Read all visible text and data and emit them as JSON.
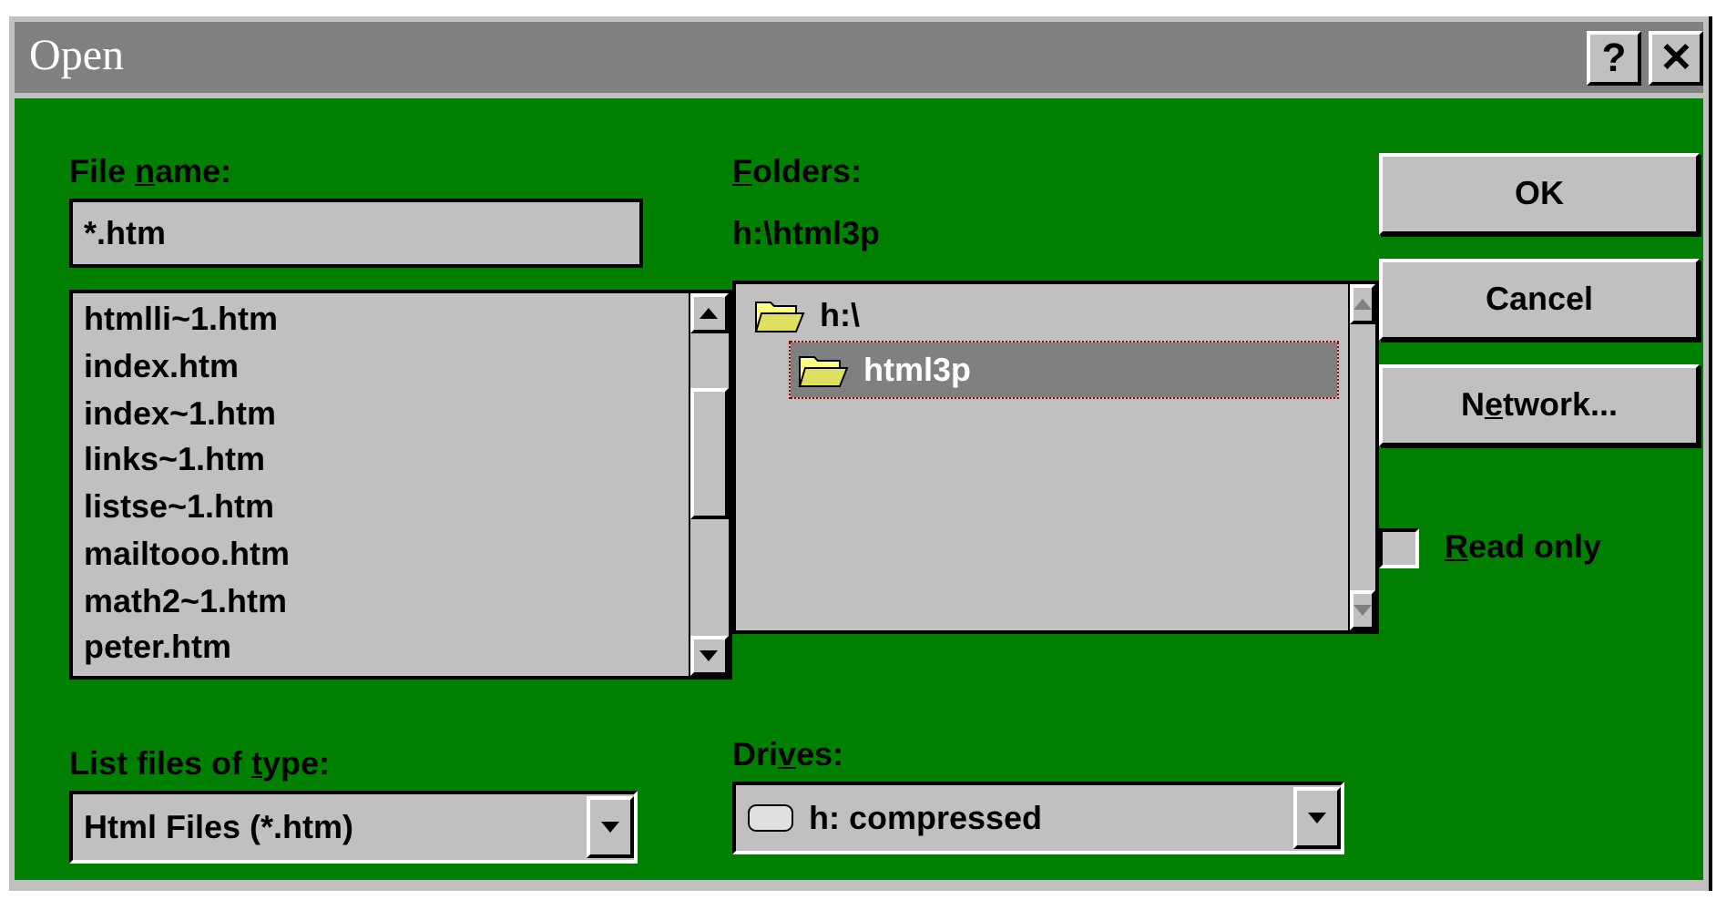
{
  "window": {
    "title": "Open",
    "title_buttons": [
      "?",
      "✕"
    ]
  },
  "file_name": {
    "label": {
      "pre": "File ",
      "key": "n",
      "post": "ame:"
    },
    "value": "*.htm"
  },
  "files": [
    {
      "name": "htmlli~1.htm",
      "selected": false
    },
    {
      "name": "index.htm",
      "selected": false
    },
    {
      "name": "index~1.htm",
      "selected": false
    },
    {
      "name": "links~1.htm",
      "selected": false
    },
    {
      "name": "listse~1.htm",
      "selected": false
    },
    {
      "name": "mailtooo.htm",
      "selected": false
    },
    {
      "name": "math2~1.htm",
      "selected": false
    },
    {
      "name": "peter.htm",
      "selected": false
    }
  ],
  "folders": {
    "label": {
      "key": "F",
      "post": "olders:"
    },
    "path": "h:\\html3p",
    "items": [
      {
        "name": "h:\\",
        "selected": false,
        "children": [
          {
            "name": "html3p",
            "selected": true
          }
        ]
      }
    ]
  },
  "buttons": [
    {
      "label": {
        "pre": "OK"
      }
    },
    {
      "label": {
        "pre": "Cancel"
      }
    },
    {
      "label": {
        "pre": "N",
        "key": "e",
        "post": "twork..."
      }
    }
  ],
  "read_only": {
    "label": {
      "key": "R",
      "post": "ead only"
    },
    "checked": false
  },
  "file_type": {
    "label": {
      "pre": "List files of ",
      "key": "t",
      "post": "ype:"
    },
    "value": "Html Files (*.htm)"
  },
  "drives": {
    "label": {
      "pre": "Dri",
      "key": "v",
      "post": "es:"
    },
    "value": "h: compressed"
  }
}
